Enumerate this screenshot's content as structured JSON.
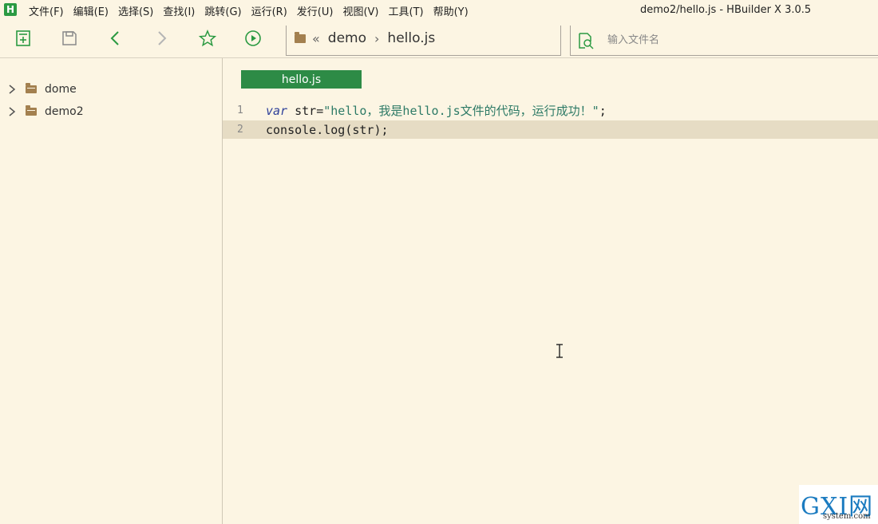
{
  "app": {
    "logo_letter": "H",
    "window_title": "demo2/hello.js - HBuilder X 3.0.5"
  },
  "menu": [
    {
      "label": "文件(F)"
    },
    {
      "label": "编辑(E)"
    },
    {
      "label": "选择(S)"
    },
    {
      "label": "查找(I)"
    },
    {
      "label": "跳转(G)"
    },
    {
      "label": "运行(R)"
    },
    {
      "label": "发行(U)"
    },
    {
      "label": "视图(V)"
    },
    {
      "label": "工具(T)"
    },
    {
      "label": "帮助(Y)"
    }
  ],
  "toolbar": {
    "icons": [
      "new-file-icon",
      "save-icon",
      "back-icon",
      "forward-icon",
      "favorite-star-icon",
      "run-icon"
    ],
    "accent_color": "#2b9a42"
  },
  "breadcrumb": {
    "back_symbol": "«",
    "folder": "demo",
    "separator": "›",
    "file": "hello.js"
  },
  "file_search": {
    "placeholder": "输入文件名",
    "value": ""
  },
  "project_tree": [
    {
      "name": "dome",
      "expanded": false
    },
    {
      "name": "demo2",
      "expanded": false
    }
  ],
  "editor": {
    "active_tab": "hello.js",
    "tab_color": "#2d8b46",
    "lines": [
      {
        "number": "1",
        "keyword": "var",
        "ident": " str=",
        "string": "\"hello，我是hello.js文件的代码，运行成功！\"",
        "tail": ";"
      },
      {
        "number": "2",
        "text": "console.log(str);"
      }
    ],
    "current_line": 2
  },
  "watermark": {
    "main": "GXI网",
    "sub": "system.com"
  }
}
